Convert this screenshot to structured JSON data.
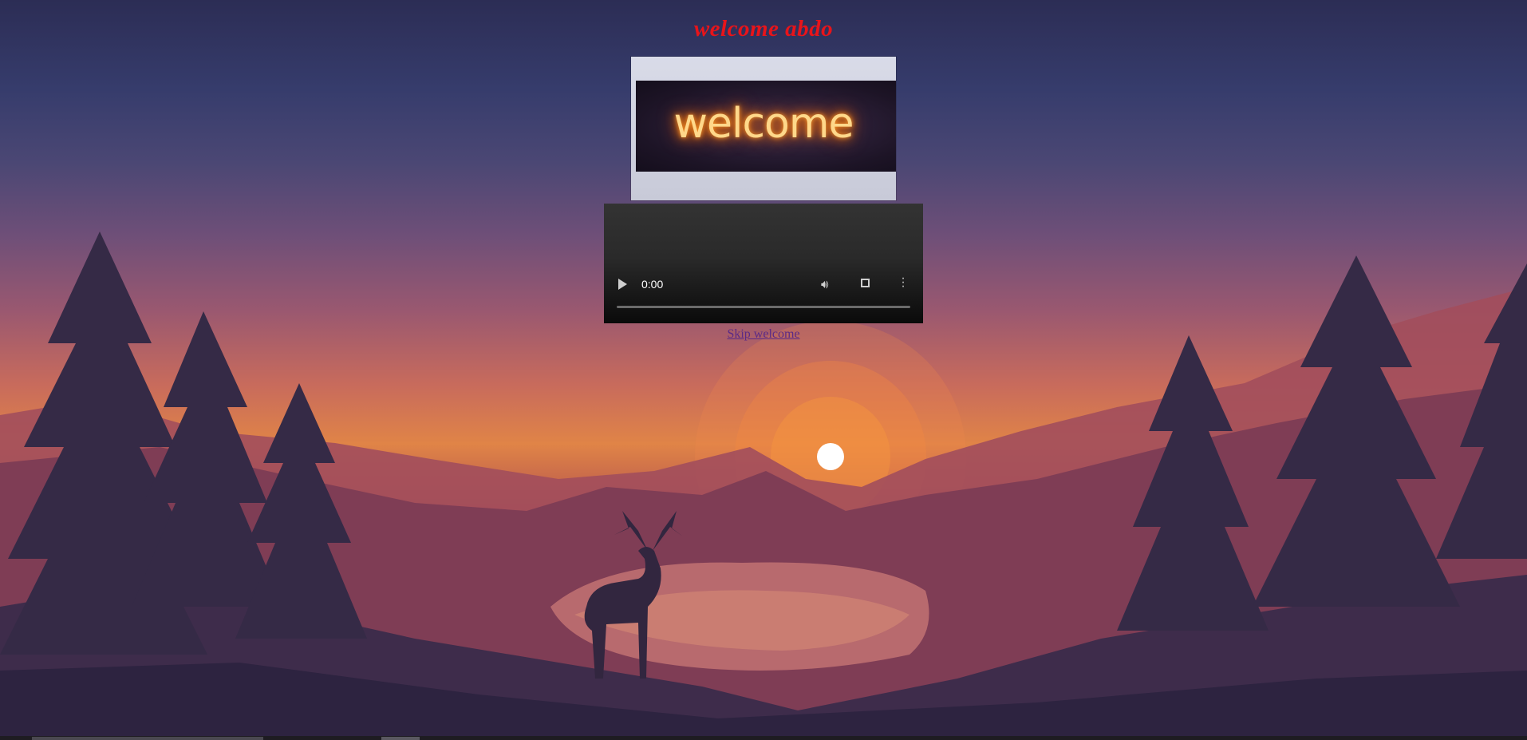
{
  "header": {
    "title": "welcome abdo"
  },
  "banner": {
    "text": "welcome"
  },
  "video": {
    "time": "0:00",
    "progress": 0
  },
  "links": {
    "skip": "Skip welcome"
  },
  "colors": {
    "title": "#e8141a",
    "link": "#5b2a86",
    "sun": "#ffffff"
  }
}
